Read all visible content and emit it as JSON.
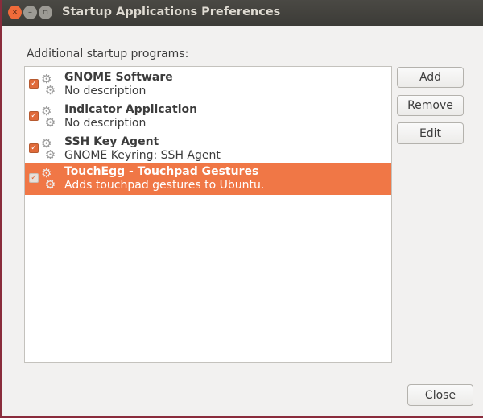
{
  "window": {
    "title": "Startup Applications Preferences"
  },
  "label": "Additional startup programs:",
  "programs": [
    {
      "name": "GNOME Software",
      "description": "No description",
      "enabled": true,
      "selected": false
    },
    {
      "name": "Indicator Application",
      "description": "No description",
      "enabled": true,
      "selected": false
    },
    {
      "name": "SSH Key Agent",
      "description": "GNOME Keyring: SSH Agent",
      "enabled": true,
      "selected": false
    },
    {
      "name": "TouchEgg - Touchpad Gestures",
      "description": "Adds touchpad gestures to Ubuntu.",
      "enabled": true,
      "selected": true
    }
  ],
  "buttons": {
    "add": "Add",
    "remove": "Remove",
    "edit": "Edit",
    "close": "Close"
  },
  "colors": {
    "selection": "#f07746",
    "titlebar": "#3c3b37"
  }
}
